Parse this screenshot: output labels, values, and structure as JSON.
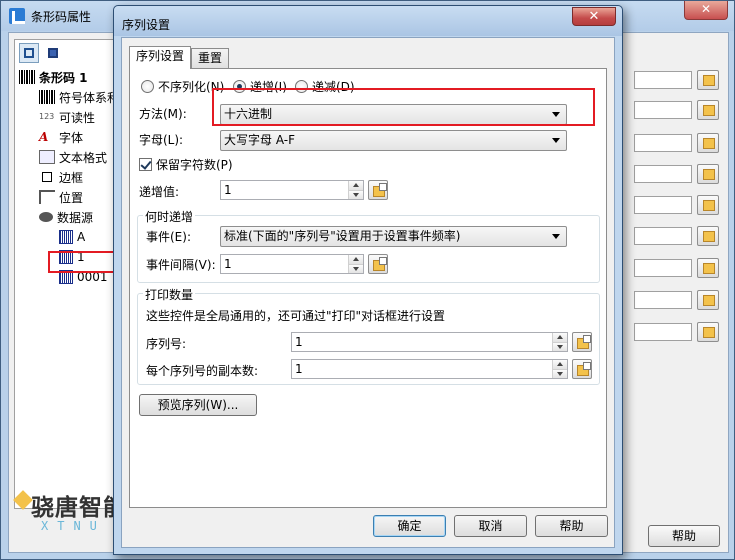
{
  "background_window": {
    "title": "条形码属性",
    "tree": {
      "root": "条形码 1",
      "items": [
        "符号体系和",
        "可读性",
        "字体",
        "文本格式",
        "边框",
        "位置",
        "数据源"
      ],
      "data_items": [
        "A",
        "1",
        "0001"
      ]
    },
    "help_button": "帮助"
  },
  "dialog": {
    "title": "序列设置",
    "close_label": "✕",
    "tabs": [
      "序列设置",
      "重置"
    ],
    "radio_options": [
      "不序列化(N)",
      "递增(I)",
      "递减(D)"
    ],
    "method_label": "方法(M):",
    "method_value": "十六进制",
    "letter_label": "字母(L):",
    "letter_value": "大写字母 A-F",
    "keep_chars_label": "保留字符数(P)",
    "increment_label": "递增值:",
    "increment_value": "1",
    "when_group": {
      "title": "何时递增",
      "event_label": "事件(E):",
      "event_value": "标准(下面的\"序列号\"设置用于设置事件频率)",
      "interval_label": "事件间隔(V):",
      "interval_value": "1"
    },
    "print_group": {
      "title": "打印数量",
      "description": "这些控件是全局通用的，还可通过\"打印\"对话框进行设置",
      "serial_label": "序列号:",
      "serial_value": "1",
      "copies_label": "每个序列号的副本数:",
      "copies_value": "1"
    },
    "preview_button": "预览序列(W)...",
    "ok_button": "确定",
    "cancel_button": "取消",
    "help_button": "帮助"
  },
  "watermark": {
    "text": "骁唐智能",
    "subtext": "XTNU"
  },
  "colors": {
    "highlight": "#e31b23",
    "titlebar": "#bfd6ee",
    "close_button": "#c44a4a"
  }
}
